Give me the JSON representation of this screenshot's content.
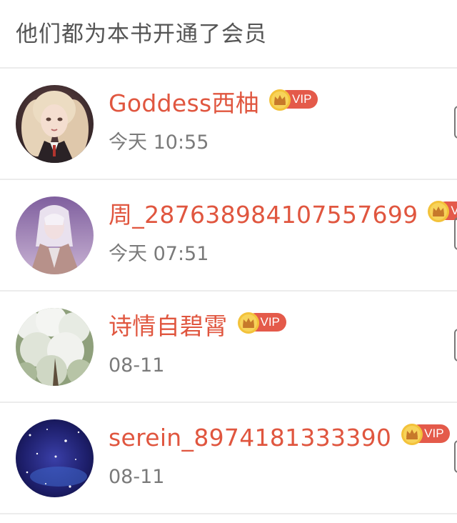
{
  "header": {
    "title": "他们都为本书开通了会员"
  },
  "members": [
    {
      "name": "Goddess西柚",
      "time": "今天 10:55",
      "badge": "VIP",
      "avatar_icon": "avatar-anime-girl-blonde"
    },
    {
      "name": "周_28763898410755769​9",
      "time": "今天 07:51",
      "badge": "VIP",
      "avatar_icon": "avatar-anime-boy-white-hair"
    },
    {
      "name": "诗情自碧霄",
      "time": "08-11",
      "badge": "VIP",
      "avatar_icon": "avatar-blossom-tree"
    },
    {
      "name": "serein_8974181333390",
      "time": "08-11",
      "badge": "VIP",
      "avatar_icon": "avatar-starry-galaxy"
    }
  ],
  "colors": {
    "name": "#e0563f",
    "vip_pill": "#e45a4a",
    "crown": "#f3c23a",
    "time": "#7a7a7a",
    "divider": "#ececec"
  }
}
